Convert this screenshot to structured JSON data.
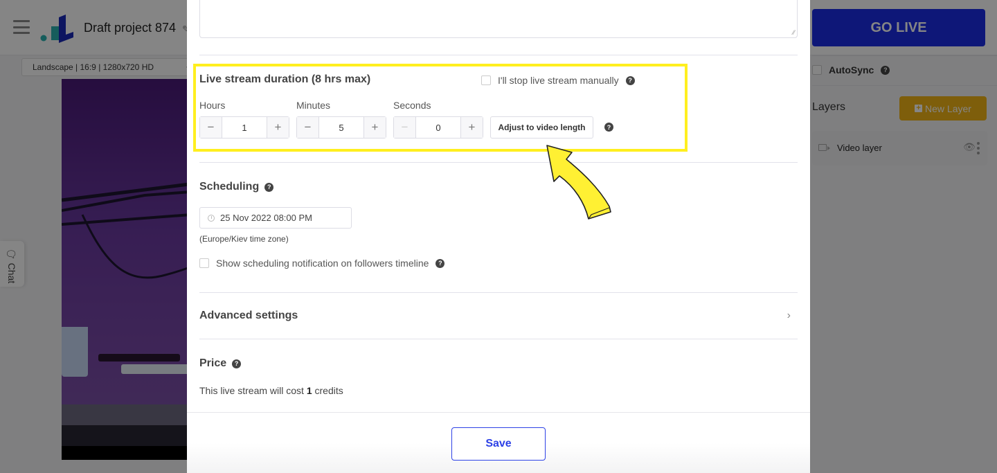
{
  "app": {
    "project_title": "Draft project 874",
    "go_live_label": "GO LIVE",
    "format_select": {
      "value": "Landscape | 16:9 | 1280x720 HD"
    },
    "chat_label": "Chat",
    "autosync_label": "AutoSync",
    "autosync_help": "?",
    "layers": {
      "title": "Layers",
      "new_layer_label": "New Layer",
      "items": [
        {
          "name": "Video layer"
        }
      ]
    },
    "colors": {
      "primary": "#1b2de6",
      "accent": "#f2b416",
      "highlight": "#ffef1f"
    }
  },
  "modal": {
    "duration": {
      "title": "Live stream duration (8 hrs max)",
      "manual_label": "I'll stop live stream manually",
      "manual_checked": false,
      "help": "?",
      "steppers": [
        {
          "label": "Hours",
          "value": "1",
          "minus": "−",
          "plus": "+"
        },
        {
          "label": "Minutes",
          "value": "5",
          "minus": "−",
          "plus": "+"
        },
        {
          "label": "Seconds",
          "value": "0",
          "minus": "−",
          "plus": "+"
        }
      ],
      "adjust_label": "Adjust to video length"
    },
    "scheduling": {
      "title": "Scheduling",
      "help": "?",
      "date_value": "25 Nov 2022 08:00 PM",
      "timezone_note": "(Europe/Kiev time zone)",
      "notify_label": "Show scheduling notification on followers timeline",
      "notify_checked": false
    },
    "advanced": {
      "label": "Advanced settings",
      "chevron": "›"
    },
    "price": {
      "title": "Price",
      "help": "?",
      "text_before": "This live stream will cost ",
      "credits": "1",
      "text_after": " credits"
    },
    "save_label": "Save"
  }
}
